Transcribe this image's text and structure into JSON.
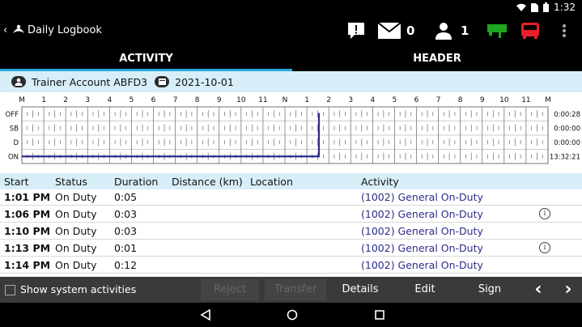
{
  "statusbar": {
    "time": "1:32",
    "icons": [
      "wifi-icon",
      "sim-icon",
      "battery-icon"
    ]
  },
  "appbar": {
    "title": "Daily Logbook",
    "message_count": "0",
    "user_count": "1",
    "icons": [
      "back-chevron-icon",
      "app-logo-icon",
      "alert-icon",
      "mail-icon",
      "person-icon",
      "trailer-icon",
      "truck-icon",
      "overflow-menu-icon"
    ],
    "colors": {
      "trailer": "#1fa51f",
      "truck": "#e8202a"
    }
  },
  "tabs": [
    {
      "label": "ACTIVITY",
      "active": true
    },
    {
      "label": "HEADER",
      "active": false
    }
  ],
  "driver": {
    "name": "Trainer Account ABFD3",
    "date": "2021-10-01"
  },
  "graph": {
    "hour_labels": [
      "M",
      "1",
      "2",
      "3",
      "4",
      "5",
      "6",
      "7",
      "8",
      "9",
      "10",
      "11",
      "N",
      "1",
      "2",
      "3",
      "4",
      "5",
      "6",
      "7",
      "8",
      "9",
      "10",
      "11",
      "M"
    ],
    "rows": [
      {
        "label": "OFF",
        "total": "0:00:28"
      },
      {
        "label": "SB",
        "total": "0:00:00"
      },
      {
        "label": "D",
        "total": "0:00:00"
      },
      {
        "label": "ON",
        "total": "13:32:21"
      }
    ],
    "line_color": "#2b2b8a"
  },
  "table": {
    "headers": {
      "start": "Start",
      "status": "Status",
      "duration": "Duration",
      "distance": "Distance (km)",
      "location": "Location",
      "activity": "Activity"
    },
    "rows": [
      {
        "start": "1:01 PM",
        "status": "On Duty",
        "duration": "0:05",
        "activity": "(1002) General On-Duty",
        "info": false
      },
      {
        "start": "1:06 PM",
        "status": "On Duty",
        "duration": "0:03",
        "activity": "(1002) General On-Duty",
        "info": true
      },
      {
        "start": "1:10 PM",
        "status": "On Duty",
        "duration": "0:03",
        "activity": "(1002) General On-Duty",
        "info": false
      },
      {
        "start": "1:13 PM",
        "status": "On Duty",
        "duration": "0:01",
        "activity": "(1002) General On-Duty",
        "info": true
      },
      {
        "start": "1:14 PM",
        "status": "On Duty",
        "duration": "0:12",
        "activity": "(1002) General On-Duty",
        "info": false
      }
    ]
  },
  "bottombar": {
    "checkbox_label": "Show system activities",
    "buttons": {
      "reject": "Reject",
      "transfer": "Transfer",
      "details": "Details",
      "edit": "Edit",
      "sign": "Sign",
      "prev": "‹",
      "next": "›"
    }
  },
  "navbar": {
    "icons": [
      "back-triangle-icon",
      "home-circle-icon",
      "recents-square-icon"
    ]
  }
}
